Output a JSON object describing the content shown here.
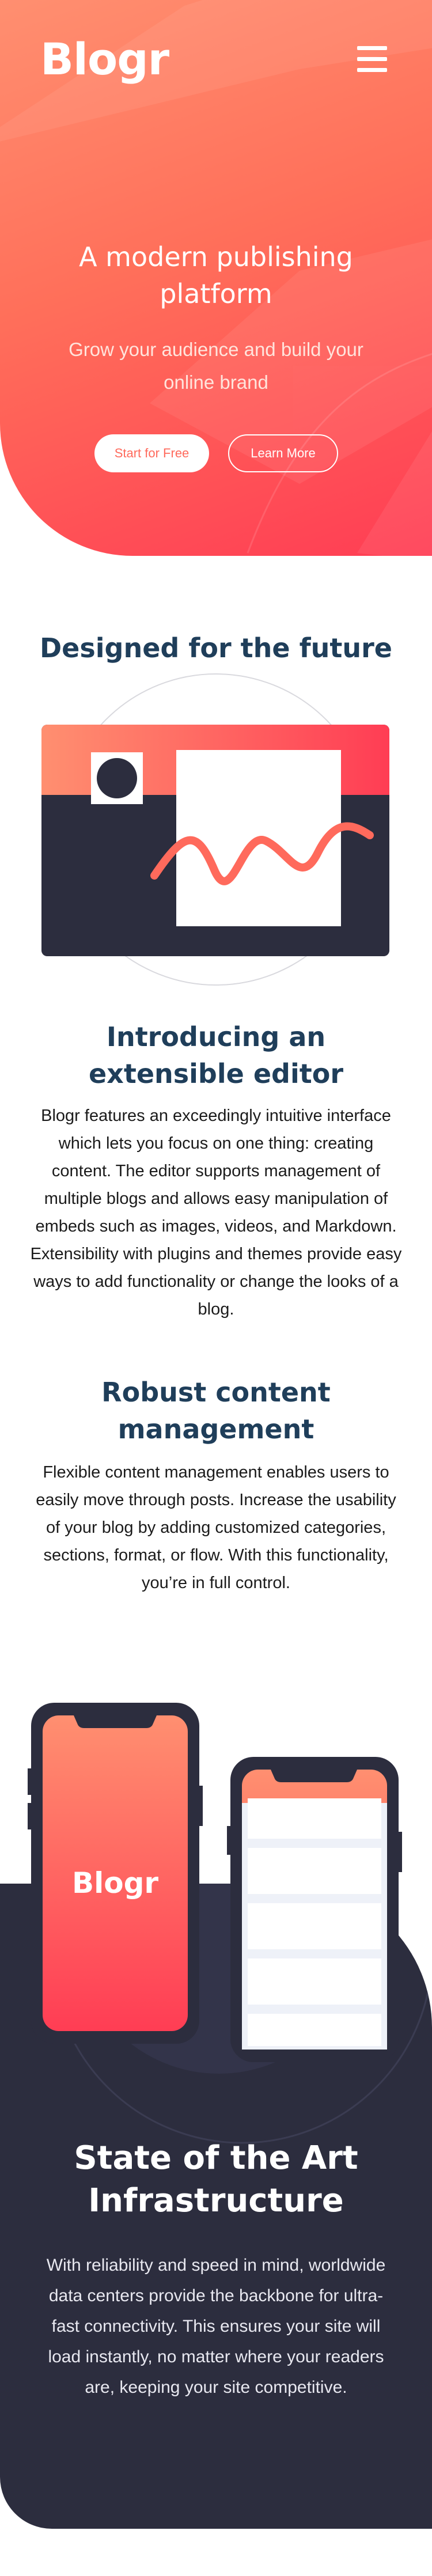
{
  "header": {
    "logo": "Blogr",
    "menu_icon": "hamburger-icon"
  },
  "hero": {
    "title": "A modern publishing platform",
    "subtitle": "Grow your audience and build your online brand",
    "primary_cta": "Start for Free",
    "secondary_cta": "Learn More"
  },
  "future": {
    "heading": "Designed for the future",
    "items": [
      {
        "title": "Introducing an extensible editor",
        "text": "Blogr features an exceedingly intuitive interface which lets you focus on one thing: creating content. The editor supports management of multiple blogs and allows easy manipulation of embeds such as images, videos, and Markdown. Extensibility with plugins and themes provide easy ways to add functionality or change the looks of a blog."
      },
      {
        "title": "Robust content management",
        "text": "Flexible content management enables users to easily move through posts. Increase the usability of your blog by adding customized categories, sections, format, or flow. With this functionality, you’re in full control."
      }
    ]
  },
  "phones": {
    "phone_logo": "Blogr"
  },
  "infrastructure": {
    "title": "State of the Art Infrastructure",
    "text": "With reliability and speed in mind, worldwide data centers provide the backbone for ultra-fast connectivity. This ensures your site will load instantly, no matter where your readers are, keeping your site competitive."
  },
  "colors": {
    "accent_light": "#ff8f70",
    "accent_dark": "#ff3d54",
    "heading": "#1f3e5a",
    "dark_bg": "#2c2d3e"
  }
}
